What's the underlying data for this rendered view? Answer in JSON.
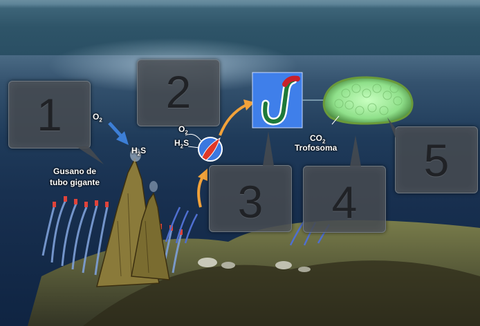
{
  "callouts": [
    {
      "number": "1"
    },
    {
      "number": "2"
    },
    {
      "number": "3"
    },
    {
      "number": "4"
    },
    {
      "number": "5"
    }
  ],
  "labels": {
    "o2_left": {
      "main": "O",
      "sub": "2"
    },
    "h2s_left": {
      "main": "H",
      "sub": "2",
      "rest": "S"
    },
    "worm_line1": "Gusano de",
    "worm_line2": "tubo gigante",
    "o2_center": {
      "main": "O",
      "sub": "2"
    },
    "h2s_center": {
      "main": "H",
      "sub": "2",
      "rest": "S"
    },
    "co2": {
      "main": "CO",
      "sub": "2"
    },
    "trophosome": "Trofosoma"
  },
  "colors": {
    "arrow_blue": "#3d7fd6",
    "arrow_orange": "#f2a23a",
    "bacteria_green": "#9fe29a",
    "worm_panel_blue": "#3f7fea"
  },
  "icons": [
    "blue-arrow-icon",
    "orange-arrow-icon",
    "bacterium-icon",
    "symbiont-worm-icon",
    "trophosome-icon"
  ]
}
